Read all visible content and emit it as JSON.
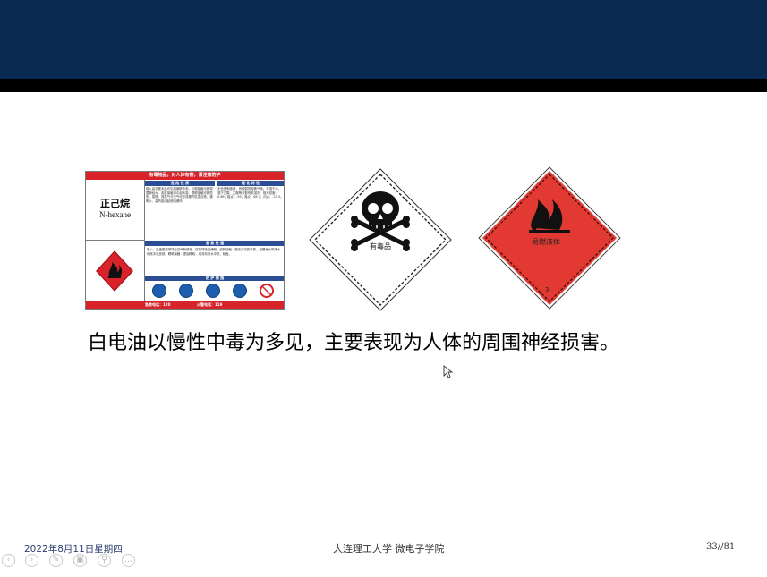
{
  "slide": {
    "main_text": "白电油以慢性中毒为多见，主要表现为人体的周围神经损害。",
    "footer": {
      "date": "2022年8月11日星期四",
      "school": "大连理工大学  微电子学院",
      "page": "33//81"
    }
  },
  "safety_card": {
    "warning": "有毒物品，对人体有害，请注意防护",
    "name_cn": "正己烷",
    "name_en": "N-hexane",
    "section_hazard": "危 险 性 质",
    "section_physical": "理 化 特 性",
    "section_emergency": "急 救 处 理",
    "section_protection": "防 护 措 施",
    "hazard_text": "吸入高浓度本品可引起麻醉作用，长期接触可致周围神经炎。皮肤接触可引起刺激，眼睛接触可致损伤。易燃，其蒸气与空气可形成爆炸性混合物，遇明火、高热能引起燃烧爆炸。",
    "physical_text": "无色透明液体，有微弱的特殊气味。不溶于水，溶于乙醇、乙醚等多数有机溶剂。相对密度：0.66；熔点：-95；沸点：68.7；闪点：-25.5。",
    "emergency_text": "吸入：迅速脱离现场至空气新鲜处，保持呼吸道通畅。皮肤接触：脱去污染的衣着，用肥皂水和清水彻底冲洗皮肤。眼睛接触：提起眼睑，用流动清水冲洗，就医。",
    "footer_left": "急救电话：120",
    "footer_right": "火警电话：119"
  },
  "hazard_signs": {
    "toxic_label": "有毒品",
    "flammable_label": "易燃液体",
    "flammable_class": "3"
  },
  "nav": {
    "buttons": [
      "prev-icon",
      "next-icon",
      "pen-icon",
      "slides-icon",
      "zoom-icon",
      "more-icon"
    ]
  },
  "colors": {
    "header": "#0b2a52",
    "card_red": "#d8232a",
    "card_blue": "#2a4d94",
    "flammable_red": "#e23a32"
  }
}
